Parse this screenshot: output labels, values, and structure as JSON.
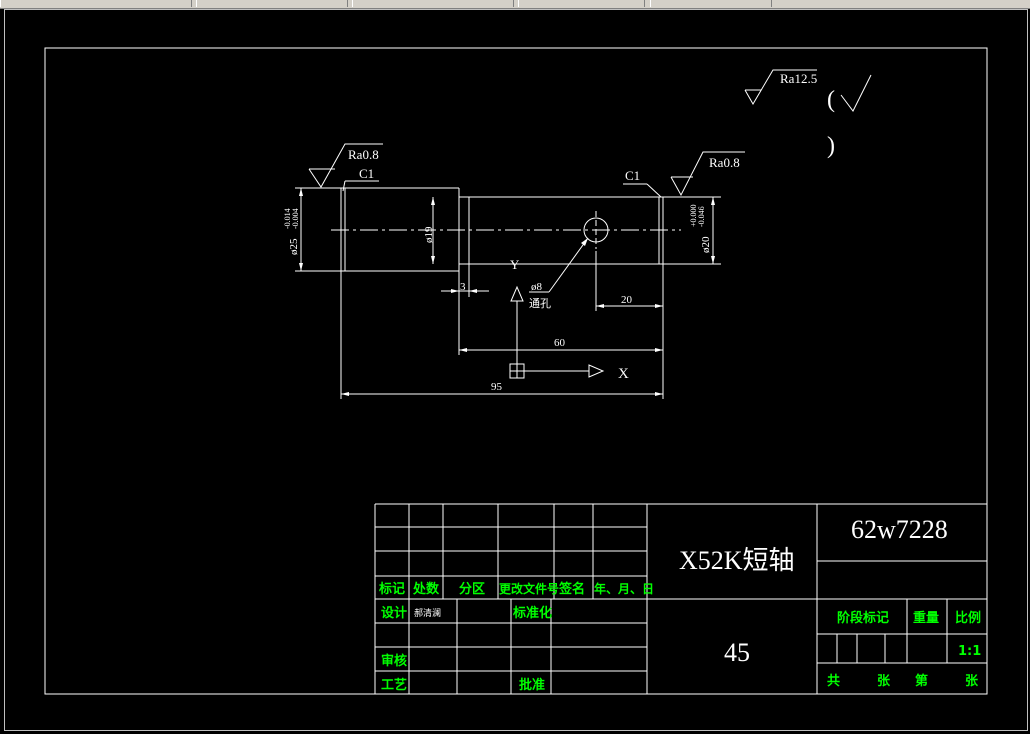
{
  "window": {
    "toolbar_glyph": "✶"
  },
  "drawing": {
    "roughness": {
      "general": "Ra12.5",
      "left_end": "Ra0.8",
      "right_end": "Ra0.8",
      "paren_open": "(",
      "paren_close": ")"
    },
    "chamfer_left": "C1",
    "chamfer_right": "C1",
    "dia_left": "ø25",
    "dia_left_tol_upper": "-0.014",
    "dia_left_tol_lower": "-0.004",
    "dia_middle": "ø19",
    "dia_right": "ø20",
    "dia_right_tol_upper": "+0.000",
    "dia_right_tol_lower": "-0.046",
    "hole_dia": "ø8",
    "hole_note": "通孔",
    "dim_3": "3",
    "dim_20": "20",
    "dim_60": "60",
    "dim_95": "95",
    "axis_y": "Y",
    "axis_x": "X"
  },
  "title_block": {
    "drawing_no": "62w7228",
    "part_name": "X52K短轴",
    "material": "45",
    "row_labels": [
      "标记",
      "处数",
      "分区",
      "更改文件号",
      "签名",
      "年、月、日"
    ],
    "design": "设计",
    "designer": "郝清澜",
    "standardize": "标准化",
    "review": "审核",
    "process": "工艺",
    "approve": "批准",
    "stage_mark": "阶段标记",
    "weight": "重量",
    "scale": "比例",
    "scale_value": "1:1",
    "total": "共",
    "sheet": "张",
    "no": "第",
    "sheet2": "张"
  }
}
